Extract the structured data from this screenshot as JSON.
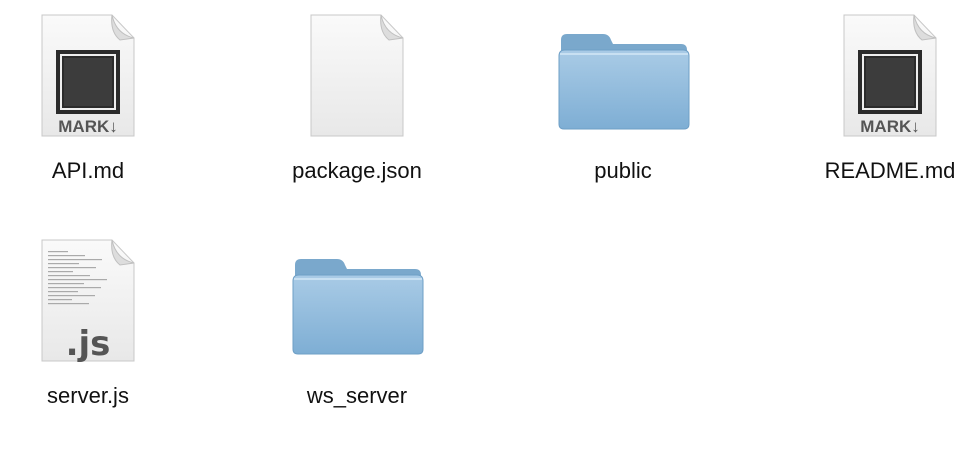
{
  "items": [
    {
      "name": "API.md",
      "type": "markdown",
      "badge": "MARK↓"
    },
    {
      "name": "package.json",
      "type": "blank"
    },
    {
      "name": "public",
      "type": "folder"
    },
    {
      "name": "README.md",
      "type": "markdown",
      "badge": "MARK↓"
    },
    {
      "name": "server.js",
      "type": "javascript",
      "badge": ".js"
    },
    {
      "name": "ws_server",
      "type": "folder"
    }
  ],
  "colors": {
    "folder": "#8db8da",
    "folder_dark": "#6e9fc6",
    "doc": "#f4f4f4",
    "markdown_box": "#333333"
  }
}
